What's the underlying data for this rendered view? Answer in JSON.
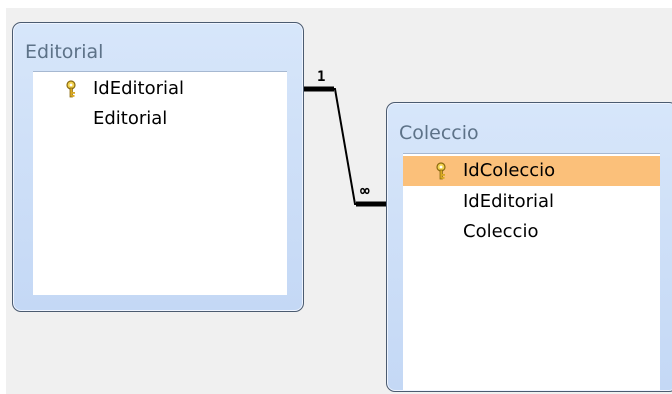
{
  "tables": [
    {
      "title": "Editorial",
      "fields": [
        {
          "name": "IdEditorial",
          "primary_key": true,
          "selected": false
        },
        {
          "name": "Editorial",
          "primary_key": false,
          "selected": false
        }
      ]
    },
    {
      "title": "Coleccio",
      "fields": [
        {
          "name": "IdColeccio",
          "primary_key": true,
          "selected": true
        },
        {
          "name": "IdEditorial",
          "primary_key": false,
          "selected": false
        },
        {
          "name": "Coleccio",
          "primary_key": false,
          "selected": false
        }
      ]
    }
  ],
  "relationship": {
    "one_side": "1",
    "many_side": "∞"
  },
  "colors": {
    "window_bg": "#c4d8f5",
    "title_text": "#5d7288",
    "selected_row": "#fbc07a",
    "canvas_bg": "#f0f0f0"
  }
}
